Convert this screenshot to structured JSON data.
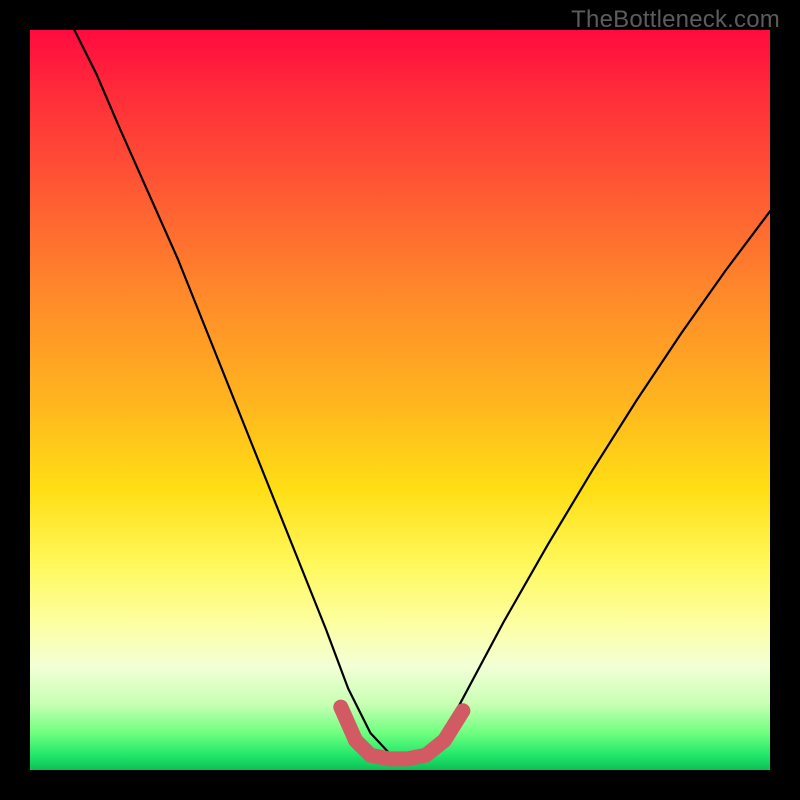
{
  "watermark": "TheBottleneck.com",
  "chart_data": {
    "type": "line",
    "title": "",
    "xlabel": "",
    "ylabel": "",
    "xlim": [
      0,
      1
    ],
    "ylim": [
      0,
      1
    ],
    "series": [
      {
        "name": "curve",
        "x": [
          0.06,
          0.09,
          0.12,
          0.16,
          0.2,
          0.24,
          0.28,
          0.32,
          0.36,
          0.4,
          0.43,
          0.46,
          0.49,
          0.52,
          0.56,
          0.6,
          0.64,
          0.7,
          0.76,
          0.82,
          0.88,
          0.94,
          1.0
        ],
        "y": [
          1.0,
          0.94,
          0.87,
          0.78,
          0.69,
          0.59,
          0.49,
          0.39,
          0.29,
          0.19,
          0.11,
          0.05,
          0.018,
          0.018,
          0.05,
          0.125,
          0.2,
          0.305,
          0.405,
          0.5,
          0.59,
          0.675,
          0.755
        ]
      },
      {
        "name": "bottom-marker",
        "x": [
          0.42,
          0.44,
          0.46,
          0.485,
          0.51,
          0.535,
          0.56,
          0.585
        ],
        "y": [
          0.085,
          0.04,
          0.02,
          0.015,
          0.015,
          0.02,
          0.04,
          0.08
        ]
      }
    ],
    "colors": {
      "curve": "#000000",
      "bottom-marker": "#d15a63"
    }
  }
}
